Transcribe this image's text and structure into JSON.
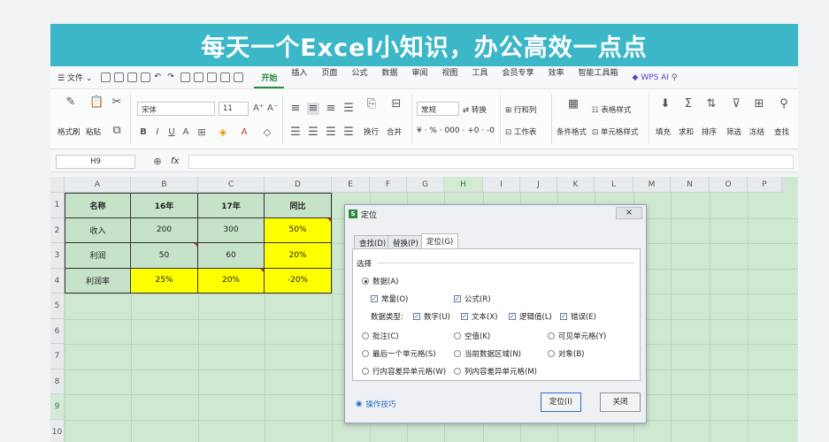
{
  "banner": {
    "title": "每天一个Excel小知识，办公高效一点点"
  },
  "menubar": {
    "file": "文件",
    "items": [
      "开始",
      "插入",
      "页面",
      "公式",
      "数据",
      "审阅",
      "视图",
      "工具",
      "会员专享",
      "效率",
      "智能工具箱"
    ],
    "active": "开始",
    "wps_ai": "WPS AI"
  },
  "ribbon": {
    "format_painter": "格式刷",
    "paste": "粘贴",
    "font_name": "宋体",
    "font_size": "11",
    "wrap": "换行",
    "merge": "合并",
    "number_format": "常规",
    "convert": "转换",
    "row_col": "行和列",
    "worksheet": "工作表",
    "cond_format": "条件格式",
    "table_style": "表格样式",
    "cell_style": "单元格样式",
    "fill": "填充",
    "sum": "求和",
    "sort": "排序",
    "filter": "筛选",
    "freeze": "冻结",
    "find": "查找"
  },
  "formula_bar": {
    "cell_ref": "H9",
    "fx": "fx"
  },
  "sheet": {
    "columns": [
      "A",
      "B",
      "C",
      "D",
      "E",
      "F",
      "G",
      "H",
      "I",
      "J",
      "K",
      "L",
      "M",
      "N",
      "O",
      "P"
    ],
    "rows": [
      "1",
      "2",
      "3",
      "4",
      "5",
      "6",
      "7",
      "8",
      "9",
      "10"
    ],
    "table": [
      [
        "名称",
        "16年",
        "17年",
        "同比"
      ],
      [
        "收入",
        "200",
        "300",
        "50%"
      ],
      [
        "利润",
        "50",
        "60",
        "20%"
      ],
      [
        "利润率",
        "25%",
        "20%",
        "-20%"
      ]
    ]
  },
  "dialog": {
    "title": "定位",
    "tabs": [
      "查找(D)",
      "替换(P)",
      "定位(G)"
    ],
    "active_tab": "定位(G)",
    "section": "选择",
    "data_option": "数据(A)",
    "constant": "常量(O)",
    "formula": "公式(R)",
    "data_type_label": "数据类型:",
    "number": "数字(U)",
    "text": "文本(X)",
    "logical": "逻辑值(L)",
    "error": "错误(E)",
    "comment": "批注(C)",
    "blank": "空值(K)",
    "visible": "可见单元格(Y)",
    "last_cell": "最后一个单元格(S)",
    "current_region": "当前数据区域(N)",
    "object": "对象(B)",
    "row_diff": "行内容差异单元格(W)",
    "col_diff": "列内容差异单元格(M)",
    "tip": "操作技巧",
    "ok": "定位(I)",
    "close": "关闭"
  }
}
